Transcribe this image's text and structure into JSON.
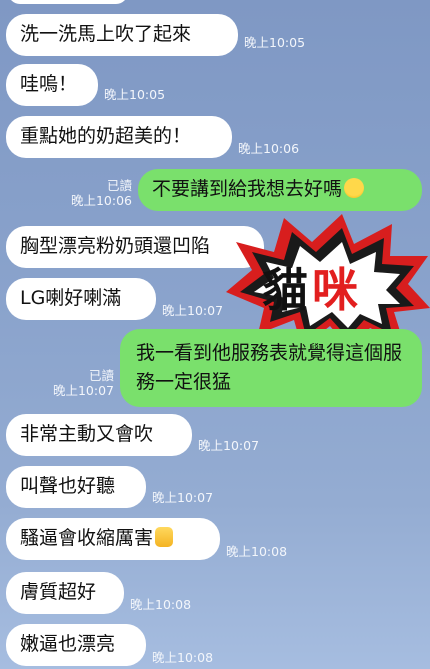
{
  "messages": [
    {
      "text": "洗一洗馬上吹了起來",
      "time": "晚上10:05"
    },
    {
      "text": "哇嗚！",
      "time": "晚上10:05"
    },
    {
      "text": "重點她的奶超美的！",
      "time": "晚上10:06"
    },
    {
      "text": "不要講到給我想去好嗎",
      "time": "晚上10:06",
      "read": "已讀",
      "emoji": "laughing-emoji"
    },
    {
      "text": "胸型漂亮粉奶頭還凹陷",
      "time": ""
    },
    {
      "text": "LG喇好喇滿",
      "time": "晚上10:07"
    },
    {
      "text": "我一看到他服務表就覺得這個服務一定很猛",
      "time": "晚上10:07",
      "read": "已讀"
    },
    {
      "text": "非常主動又會吹",
      "time": "晚上10:07"
    },
    {
      "text": "叫聲也好聽",
      "time": "晚上10:07"
    },
    {
      "text": "騷逼會收縮厲害",
      "time": "晚上10:08",
      "emoji": "thumbs-up-emoji"
    },
    {
      "text": "膚質超好",
      "time": "晚上10:08"
    },
    {
      "text": "嫩逼也漂亮",
      "time": "晚上10:08"
    }
  ],
  "stamp": {
    "text_black": "貓",
    "text_red": "咪"
  },
  "colors": {
    "incoming": "#ffffff",
    "outgoing": "#7ae06c",
    "stamp_red": "#e21f1f"
  }
}
